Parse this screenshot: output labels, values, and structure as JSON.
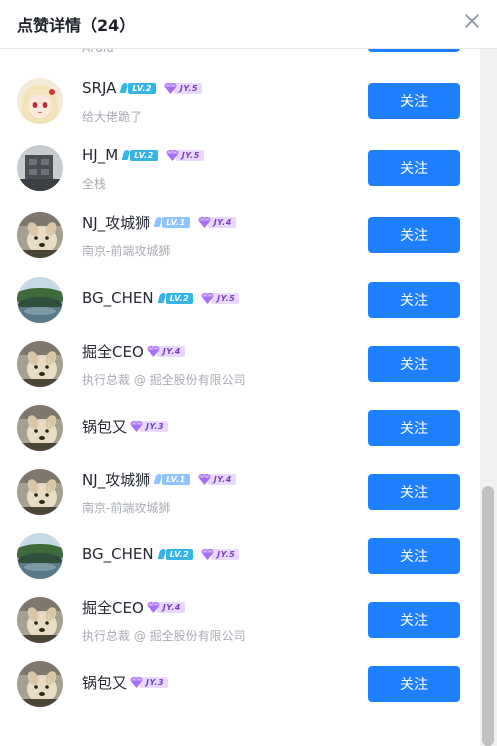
{
  "header": {
    "title": "点赞详情（24）"
  },
  "partial_row": {
    "text": "Arulu"
  },
  "users": [
    {
      "name": "SRJA",
      "level": "LV.2",
      "jy": "JY.5",
      "desc": "给大佬跪了",
      "follow_label": "关注",
      "avatar": "anime"
    },
    {
      "name": "HJ_M",
      "level": "LV.2",
      "jy": "JY.5",
      "desc": "全栈",
      "follow_label": "关注",
      "avatar": "building"
    },
    {
      "name": "NJ_攻城狮",
      "level": "LV.1",
      "jy": "JY.4",
      "desc": "南京-前端攻城狮",
      "follow_label": "关注",
      "avatar": "dog"
    },
    {
      "name": "BG_CHEN",
      "level": "LV.2",
      "jy": "JY.5",
      "desc": "",
      "follow_label": "关注",
      "avatar": "landscape"
    },
    {
      "name": "掘全CEO",
      "level": "",
      "jy": "JY.4",
      "desc": "执行总裁 @ 掘全股份有限公司",
      "follow_label": "关注",
      "avatar": "dog"
    },
    {
      "name": "锅包又",
      "level": "",
      "jy": "JY.3",
      "desc": "",
      "follow_label": "关注",
      "avatar": "dog"
    },
    {
      "name": "NJ_攻城狮",
      "level": "LV.1",
      "jy": "JY.4",
      "desc": "南京-前端攻城狮",
      "follow_label": "关注",
      "avatar": "dog"
    },
    {
      "name": "BG_CHEN",
      "level": "LV.2",
      "jy": "JY.5",
      "desc": "",
      "follow_label": "关注",
      "avatar": "landscape"
    },
    {
      "name": "掘全CEO",
      "level": "",
      "jy": "JY.4",
      "desc": "执行总裁 @ 掘全股份有限公司",
      "follow_label": "关注",
      "avatar": "dog"
    },
    {
      "name": "锅包又",
      "level": "",
      "jy": "JY.3",
      "desc": "",
      "follow_label": "关注",
      "avatar": "dog"
    }
  ],
  "colors": {
    "accent": "#1e80ff",
    "lv1": "#8fc3ff",
    "lv2": "#35b4e6"
  }
}
